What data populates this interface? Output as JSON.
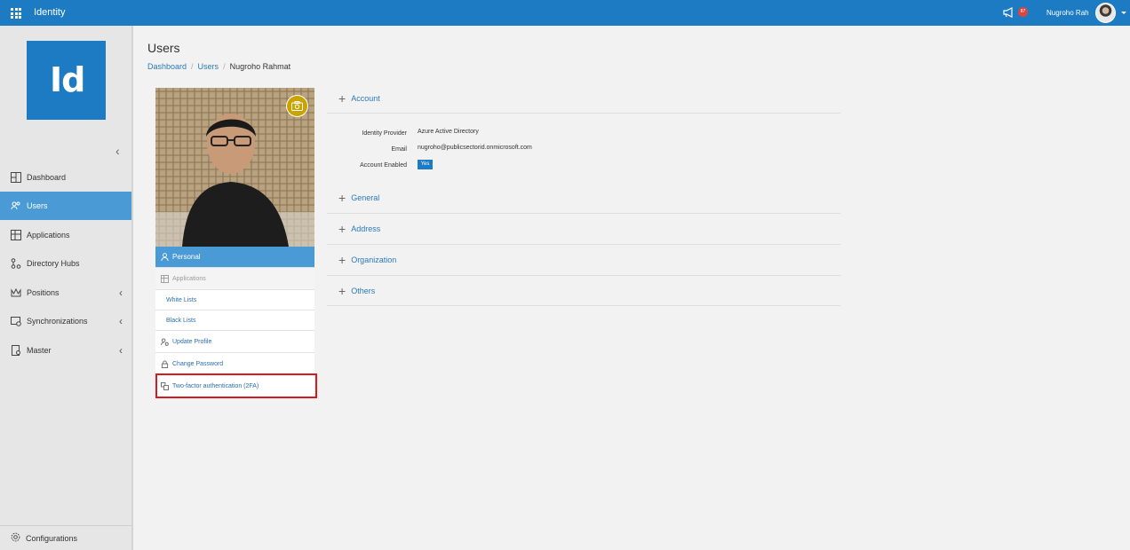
{
  "app": {
    "name": "Identity",
    "logo_text": "Id"
  },
  "topbar": {
    "notification_count": "87",
    "user_name": "Nugroho Rah"
  },
  "sidebar": {
    "items": [
      {
        "label": "Dashboard",
        "icon": "dashboard-icon",
        "active": false,
        "expandable": false
      },
      {
        "label": "Users",
        "icon": "users-icon",
        "active": true,
        "expandable": false
      },
      {
        "label": "Applications",
        "icon": "applications-icon",
        "active": false,
        "expandable": false
      },
      {
        "label": "Directory Hubs",
        "icon": "directory-hubs-icon",
        "active": false,
        "expandable": false
      },
      {
        "label": "Positions",
        "icon": "positions-icon",
        "active": false,
        "expandable": true
      },
      {
        "label": "Synchronizations",
        "icon": "sync-icon",
        "active": false,
        "expandable": true
      },
      {
        "label": "Master",
        "icon": "master-icon",
        "active": false,
        "expandable": true
      }
    ],
    "footer_label": "Configurations"
  },
  "page": {
    "title": "Users",
    "breadcrumb": [
      "Dashboard",
      "Users",
      "Nugroho Rahmat"
    ]
  },
  "profile_menu": {
    "personal": "Personal",
    "applications": "Applications",
    "white_lists": "White Lists",
    "black_lists": "Black Lists",
    "update_profile": "Update Profile",
    "change_password": "Change Password",
    "two_factor": "Two-factor authentication (2FA)"
  },
  "sections": {
    "account": "Account",
    "general": "General",
    "address": "Address",
    "organization": "Organization",
    "others": "Others"
  },
  "account": {
    "identity_provider_label": "Identity Provider",
    "identity_provider_value": "Azure Active Directory",
    "email_label": "Email",
    "email_value": "nugroho@publicsectorid.onmicrosoft.com",
    "enabled_label": "Account Enabled",
    "enabled_value": "Yes"
  },
  "colors": {
    "primary": "#1d7bc3",
    "active": "#4a9ad6",
    "highlight": "#d71920",
    "camera": "#c9a400"
  }
}
